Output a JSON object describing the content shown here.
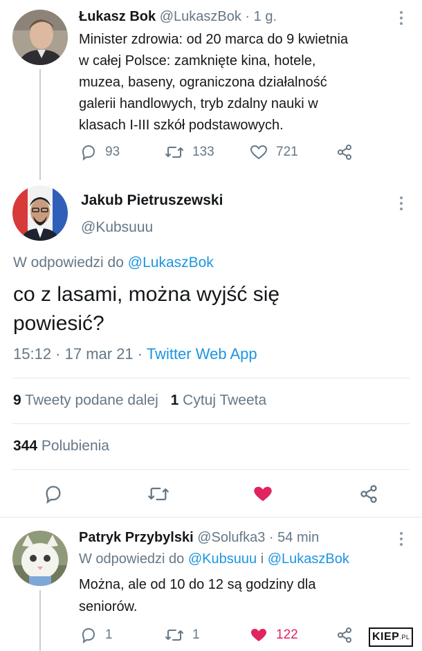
{
  "tweet1": {
    "name": "Łukasz Bok",
    "handle": "@LukaszBok",
    "sep": "·",
    "time": "1 g.",
    "lines": [
      "Minister zdrowia: od 20 marca do 9 kwietnia",
      "w całej Polsce: zamknięte kina, hotele,",
      "muzea, baseny, ograniczona działalność",
      "galerii handlowych, tryb zdalny nauki w",
      "klasach I-III szkół podstawowych."
    ],
    "replies": "93",
    "retweets": "133",
    "likes": "721"
  },
  "tweet2": {
    "name": "Jakub Pietruszewski",
    "handle": "@Kubsuuu",
    "reply_prefix": "W odpowiedzi do",
    "reply_to": "@LukaszBok",
    "text_line1": "co z lasami, można wyjść się",
    "text_line2": "powiesić?",
    "timestamp": "15:12 · 17 mar 21 ·",
    "source": "Twitter Web App",
    "retweets_count": "9",
    "retweets_label": "Tweety podane dalej",
    "quotes_count": "1",
    "quotes_label": "Cytuj Tweeta",
    "likes_count": "344",
    "likes_label": "Polubienia"
  },
  "tweet3": {
    "name": "Patryk Przybylski",
    "handle": "@Solufka3",
    "sep": "·",
    "time": "54 min",
    "reply_prefix": "W odpowiedzi do",
    "reply_to_1": "@Kubsuuu",
    "reply_and": "i",
    "reply_to_2": "@LukaszBok",
    "line1": "Można, ale od 10 do 12 są godziny dla",
    "line2": "seniorów.",
    "replies": "1",
    "retweets": "1",
    "likes": "122"
  },
  "watermark": {
    "text": "KIEP",
    "suffix": ".PL"
  },
  "colors": {
    "accent": "#1b95e0",
    "like": "#e0245e",
    "muted": "#657786"
  }
}
